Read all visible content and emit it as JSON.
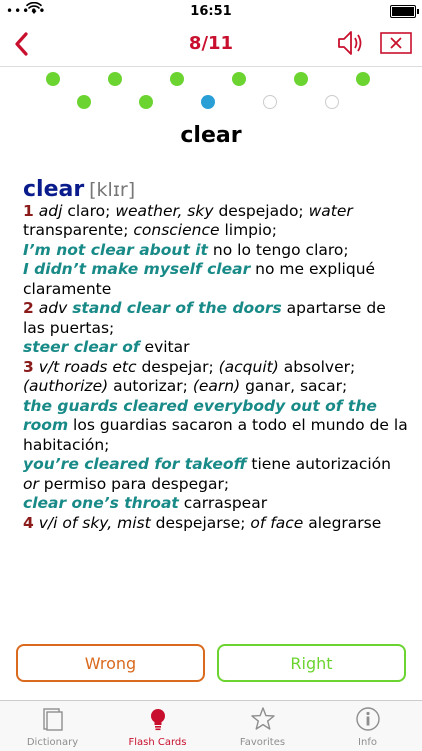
{
  "status": {
    "carrier": "•••••",
    "time": "16:51"
  },
  "nav": {
    "title": "8/11"
  },
  "progress": [
    "done",
    "done",
    "done",
    "done",
    "done",
    "done",
    "done",
    "done",
    "current",
    "empty",
    "empty"
  ],
  "colors": {
    "accent": "#c8102e",
    "done": "#6cd430",
    "current": "#2a9fd6",
    "wrong": "#d96a1e",
    "example": "#188a87",
    "headword": "#0a1c8c",
    "sense_number": "#8b1a1a"
  },
  "card": {
    "word": "clear"
  },
  "entry": {
    "headword": "clear",
    "pronunciation": "[klɪr]",
    "s1": {
      "num": "1",
      "pos": "adj",
      "t1": "claro;",
      "c1": "weather, sky",
      "t2": "despejado;",
      "c2": "water",
      "t3": "transparente;",
      "c3": "conscience",
      "t4": "limpio;"
    },
    "e1": {
      "phrase": "I’m not clear about it",
      "tr": "no lo tengo claro;"
    },
    "e2": {
      "phrase": "I didn’t make myself clear",
      "tr": "no me expliqué claramente"
    },
    "s2": {
      "num": "2",
      "pos": "adv",
      "phrase": "stand clear of the doors",
      "tr": "apartarse de las puertas;"
    },
    "e3": {
      "phrase": "steer clear of",
      "tr": "evitar"
    },
    "s3": {
      "num": "3",
      "pos": "v/t",
      "c1": "roads etc",
      "t1": "despejar;",
      "c2": "(acquit)",
      "t2": "absolver;",
      "c3": "(authorize)",
      "t3": "autorizar;",
      "c4": "(earn)",
      "t4": "ganar, sacar;"
    },
    "e4": {
      "phrase": "the guards cleared everybody out of the room",
      "tr": "los guardias sacaron a todo el mundo de la habitación;"
    },
    "e5": {
      "phrase": "you’re cleared for takeoff",
      "tr1": "tiene autorización",
      "or": "or",
      "tr2": "permiso para despegar;"
    },
    "e6": {
      "phrase": "clear one’s throat",
      "tr": "carraspear"
    },
    "s4": {
      "num": "4",
      "pos": "v/i",
      "c1": "of sky, mist",
      "t1": "despejarse;",
      "c2": "of face",
      "t2": "alegrarse"
    }
  },
  "buttons": {
    "wrong": "Wrong",
    "right": "Right"
  },
  "tabs": [
    {
      "label": "Dictionary",
      "icon": "dictionary-icon"
    },
    {
      "label": "Flash Cards",
      "icon": "lightbulb-icon",
      "active": true
    },
    {
      "label": "Favorites",
      "icon": "star-icon"
    },
    {
      "label": "Info",
      "icon": "info-icon"
    }
  ]
}
